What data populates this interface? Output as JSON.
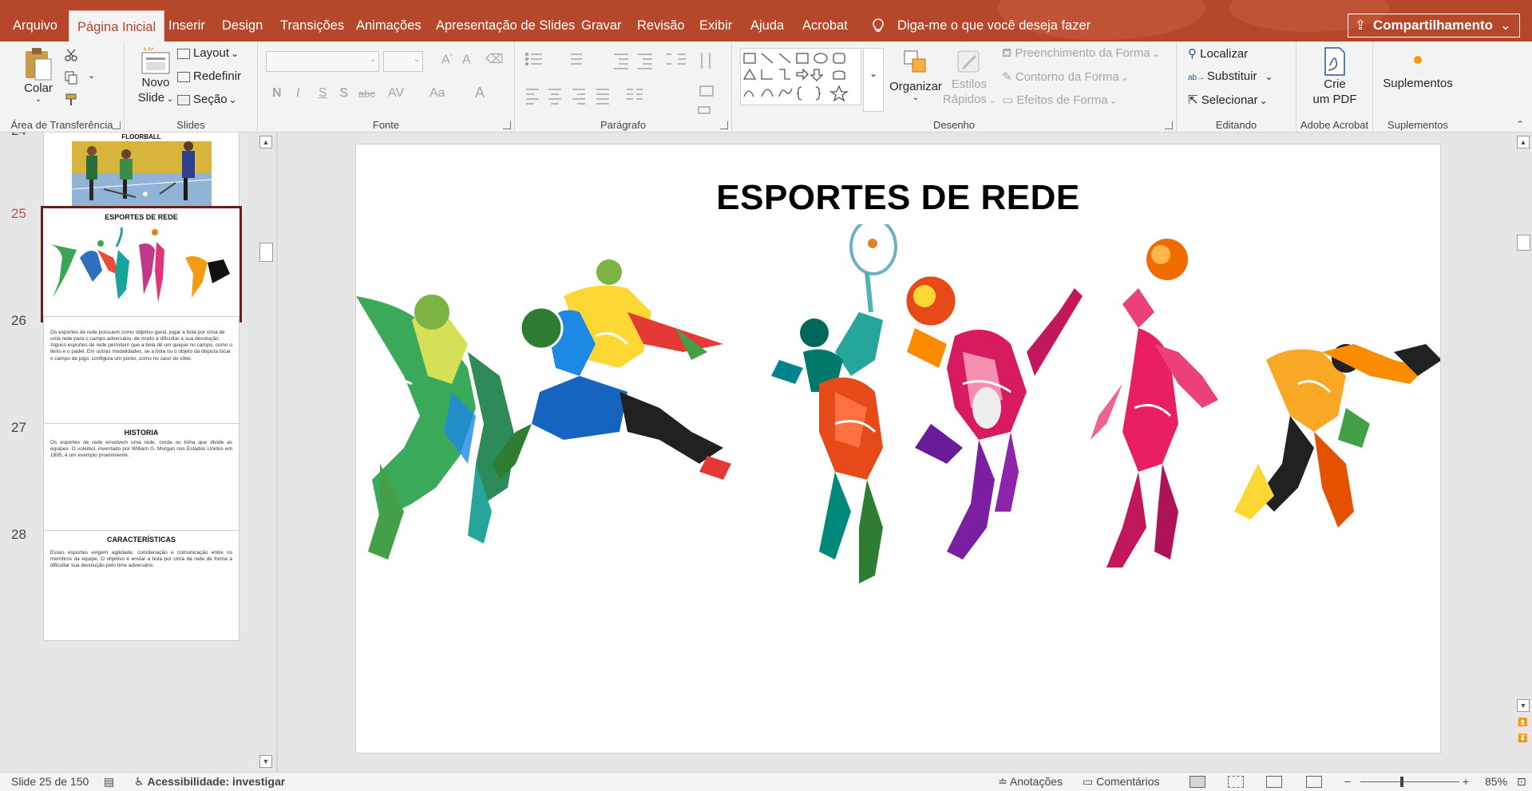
{
  "tabs": [
    {
      "label": "Arquivo",
      "active": false
    },
    {
      "label": "Página Inicial",
      "active": true
    },
    {
      "label": "Inserir",
      "active": false
    },
    {
      "label": "Design",
      "active": false
    },
    {
      "label": "Transições",
      "active": false
    },
    {
      "label": "Animações",
      "active": false
    },
    {
      "label": "Apresentação de Slides",
      "active": false
    },
    {
      "label": "Gravar",
      "active": false
    },
    {
      "label": "Revisão",
      "active": false
    },
    {
      "label": "Exibir",
      "active": false
    },
    {
      "label": "Ajuda",
      "active": false
    },
    {
      "label": "Acrobat",
      "active": false
    }
  ],
  "tell_me": "Diga-me o que você deseja fazer",
  "share_label": "Compartilhamento",
  "ribbon": {
    "clipboard": {
      "label": "Área de Transferência",
      "paste": "Colar"
    },
    "slides": {
      "label": "Slides",
      "new_slide_1": "Novo",
      "new_slide_2": "Slide",
      "layout": "Layout",
      "reset": "Redefinir",
      "section": "Seção"
    },
    "font": {
      "label": "Fonte",
      "buttons": [
        "N",
        "I",
        "S",
        "S",
        "abc",
        "AV",
        "Aa",
        "A"
      ]
    },
    "paragraph": {
      "label": "Parágrafo"
    },
    "drawing": {
      "label": "Desenho",
      "arrange": "Organizar",
      "quick_styles_1": "Estilos",
      "quick_styles_2": "Rápidos",
      "shape_fill": "Preenchimento da Forma",
      "shape_outline": "Contorno da Forma",
      "shape_effects": "Efeitos de Forma"
    },
    "editing": {
      "label": "Editando",
      "find": "Localizar",
      "replace": "Substituir",
      "select": "Selecionar"
    },
    "acrobat": {
      "label": "Adobe Acrobat",
      "create_pdf_1": "Crie",
      "create_pdf_2": "um PDF"
    },
    "addins": {
      "label": "Suplementos",
      "button": "Suplementos"
    }
  },
  "thumbnails": [
    {
      "number": "24",
      "title": "FLOORBALL",
      "body": "",
      "active": false
    },
    {
      "number": "25",
      "title": "ESPORTES DE REDE",
      "body": "",
      "active": true
    },
    {
      "number": "26",
      "title": "",
      "body": "Os esportes de rede possuem como objetivo geral, jogar a bola por cima de uma rede para o campo adversário, de modo a dificultar a sua devolução. Alguns esportes de rede permitem que a bola dê um quique no campo, como o tênis e o padel. Em outras modalidades, se a bola ou o objeto da disputa tocar o campo de jogo, configura um ponto, como no caso do vôlei.",
      "active": false
    },
    {
      "number": "27",
      "title": "HISTORIA",
      "body": "Os esportes de rede envolvem uma rede, corda ou linha que divide as equipes. O voleibol, inventado por William G. Morgan nos Estados Unidos em 1895, é um exemplo proeminente.",
      "active": false
    },
    {
      "number": "28",
      "title": "CARACTERÍSTICAS",
      "body": "Esses esportes exigem agilidade, coordenação e comunicação entre os membros da equipe. O objetivo é enviar a bola por cima da rede de forma a dificultar sua devolução pelo time adversário.",
      "active": false
    }
  ],
  "slide": {
    "title": "ESPORTES DE REDE"
  },
  "status": {
    "slide_counter": "Slide 25 de 150",
    "accessibility": "Acessibilidade: investigar",
    "notes": "Anotações",
    "comments": "Comentários",
    "zoom": "85%",
    "zoom_fraction": 0.85
  },
  "colors": {
    "accent": "#b7472a",
    "active_thumb_border": "#6b1f1a",
    "slide_number_active": "#c0504d"
  }
}
